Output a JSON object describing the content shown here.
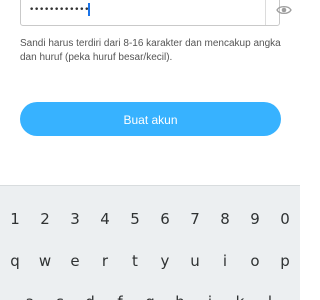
{
  "password_field": {
    "masked_value": "••••••••••••",
    "visibility_icon": "eye-icon"
  },
  "helper_text": "Sandi harus terdiri dari 8-16 karakter dan mencakup angka dan huruf (peka huruf besar/kecil).",
  "create_account_button": "Buat akun",
  "colors": {
    "button": "#37b2ff",
    "caret": "#1a73e8",
    "keyboard_bg": "#eceff1"
  },
  "keyboard": {
    "digits": [
      "1",
      "2",
      "3",
      "4",
      "5",
      "6",
      "7",
      "8",
      "9",
      "0"
    ],
    "row1": [
      "q",
      "w",
      "e",
      "r",
      "t",
      "y",
      "u",
      "i",
      "o",
      "p"
    ],
    "row2": [
      "a",
      "s",
      "d",
      "f",
      "g",
      "h",
      "j",
      "k",
      "l"
    ]
  }
}
